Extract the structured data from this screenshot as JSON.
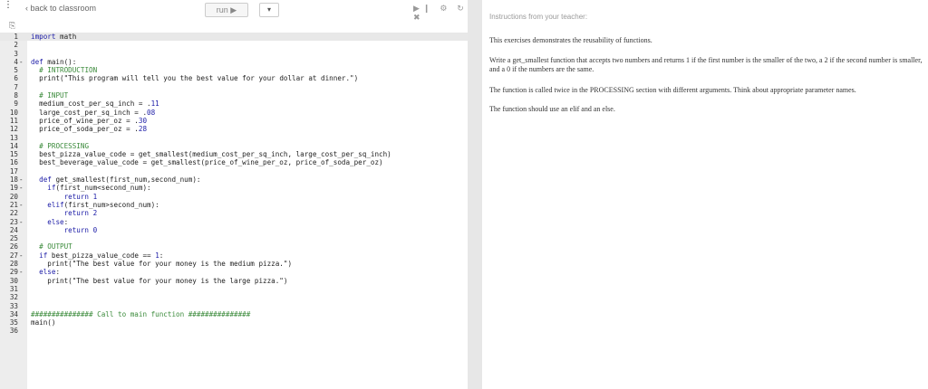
{
  "toolbar": {
    "menu_icon": "vertical-dots",
    "back_label": "back to classroom",
    "run_label": "run ▶",
    "dropdown_symbol": "▾",
    "icons": "▶❙ ⚙ ↻ ✖",
    "file_icon": "⎘"
  },
  "editor": {
    "lines": [
      {
        "n": "1",
        "f": "",
        "text": "import math",
        "active": true
      },
      {
        "n": "2",
        "f": "",
        "text": ""
      },
      {
        "n": "3",
        "f": "",
        "text": ""
      },
      {
        "n": "4",
        "f": "-",
        "text": "def main():"
      },
      {
        "n": "5",
        "f": "",
        "text": "  # INTRODUCTION"
      },
      {
        "n": "6",
        "f": "",
        "text": "  print(\"This program will tell you the best value for your dollar at dinner.\")"
      },
      {
        "n": "7",
        "f": "",
        "text": ""
      },
      {
        "n": "8",
        "f": "",
        "text": "  # INPUT"
      },
      {
        "n": "9",
        "f": "",
        "text": "  medium_cost_per_sq_inch = .11"
      },
      {
        "n": "10",
        "f": "",
        "text": "  large_cost_per_sq_inch = .08"
      },
      {
        "n": "11",
        "f": "",
        "text": "  price_of_wine_per_oz = .30"
      },
      {
        "n": "12",
        "f": "",
        "text": "  price_of_soda_per_oz = .28"
      },
      {
        "n": "13",
        "f": "",
        "text": ""
      },
      {
        "n": "14",
        "f": "",
        "text": "  # PROCESSING"
      },
      {
        "n": "15",
        "f": "",
        "text": "  best_pizza_value_code = get_smallest(medium_cost_per_sq_inch, large_cost_per_sq_inch)"
      },
      {
        "n": "16",
        "f": "",
        "text": "  best_beverage_value_code = get_smallest(price_of_wine_per_oz, price_of_soda_per_oz)"
      },
      {
        "n": "17",
        "f": "",
        "text": ""
      },
      {
        "n": "18",
        "f": "-",
        "text": "  def get_smallest(first_num,second_num):"
      },
      {
        "n": "19",
        "f": "-",
        "text": "    if(first_num<second_num):"
      },
      {
        "n": "20",
        "f": "",
        "text": "        return 1"
      },
      {
        "n": "21",
        "f": "-",
        "text": "    elif(first_num>second_num):"
      },
      {
        "n": "22",
        "f": "",
        "text": "        return 2"
      },
      {
        "n": "23",
        "f": "-",
        "text": "    else:"
      },
      {
        "n": "24",
        "f": "",
        "text": "        return 0"
      },
      {
        "n": "25",
        "f": "",
        "text": ""
      },
      {
        "n": "26",
        "f": "",
        "text": "  # OUTPUT"
      },
      {
        "n": "27",
        "f": "-",
        "text": "  if best_pizza_value_code == 1:"
      },
      {
        "n": "28",
        "f": "",
        "text": "    print(\"The best value for your money is the medium pizza.\")"
      },
      {
        "n": "29",
        "f": "-",
        "text": "  else:"
      },
      {
        "n": "30",
        "f": "",
        "text": "    print(\"The best value for your money is the large pizza.\")"
      },
      {
        "n": "31",
        "f": "",
        "text": ""
      },
      {
        "n": "32",
        "f": "",
        "text": ""
      },
      {
        "n": "33",
        "f": "",
        "text": ""
      },
      {
        "n": "34",
        "f": "",
        "text": "############### Call to main function ###############"
      },
      {
        "n": "35",
        "f": "",
        "text": "main()"
      },
      {
        "n": "36",
        "f": "",
        "text": ""
      }
    ]
  },
  "instructions": {
    "title": "Instructions from your teacher:",
    "paragraphs": [
      "This exercises demonstrates the reusability of functions.",
      "Write a get_smallest function that accepts two numbers and returns 1 if the first number is the smaller of the two, a 2 if the second number is smaller, and a 0 if the numbers are the same.",
      "The function is called twice in the PROCESSING section with different arguments. Think about appropriate parameter names.",
      "The function should use an elif and an else."
    ]
  }
}
